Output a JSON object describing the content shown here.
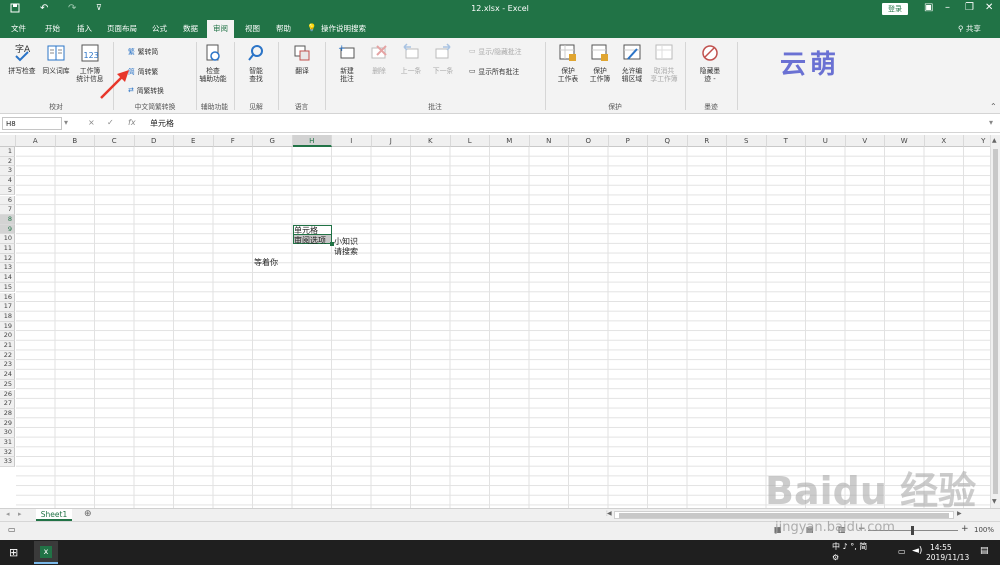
{
  "titlebar": {
    "title": "12.xlsx  -  Excel",
    "login_label": "登录",
    "save_icon": "save-icon",
    "undo_icon": "undo-icon",
    "redo_icon": "redo-icon",
    "customize_icon": "customize-icon"
  },
  "tabs": [
    {
      "label": "文件"
    },
    {
      "label": "开始"
    },
    {
      "label": "插入"
    },
    {
      "label": "页面布局"
    },
    {
      "label": "公式"
    },
    {
      "label": "数据"
    },
    {
      "label": "审阅",
      "active": true
    },
    {
      "label": "视图"
    },
    {
      "label": "帮助"
    },
    {
      "label": "操作说明搜索"
    }
  ],
  "share_label": "共享",
  "ribbon": {
    "proofing": {
      "spell_label": "拼写检查",
      "thesaurus_label": "同义词库",
      "stats_label_1": "工作簿",
      "stats_label_2": "统计信息",
      "group_label": "校对"
    },
    "chinese": {
      "to_simplified": "繁转简",
      "to_traditional": "简转繁",
      "convert": "简繁转换",
      "group_label": "中文简繁转换"
    },
    "accessibility": {
      "check_label_1": "检查",
      "check_label_2": "辅助功能",
      "group_label": "辅助功能"
    },
    "insights": {
      "smart_label_1": "智能",
      "smart_label_2": "查找",
      "group_label": "见解"
    },
    "language": {
      "translate_label": "翻译",
      "group_label": "语言"
    },
    "comments": {
      "new_label_1": "新建",
      "new_label_2": "批注",
      "delete_label": "删除",
      "prev_label": "上一条",
      "next_label": "下一条",
      "show_hide_label": "显示/隐藏批注",
      "show_all_label": "显示所有批注",
      "group_label": "批注"
    },
    "protect": {
      "sheet_1": "保护",
      "sheet_2": "工作表",
      "book_1": "保护",
      "book_2": "工作簿",
      "ranges_1": "允许编",
      "ranges_2": "辑区域",
      "unshare_1": "取消共",
      "unshare_2": "享工作簿",
      "group_label": "保护"
    },
    "ink": {
      "hide_1": "隐藏墨",
      "hide_2": "迹 -",
      "group_label": "墨迹"
    }
  },
  "formula_bar": {
    "name_box": "H8",
    "cancel": "×",
    "enter": "✓",
    "fx": "fx",
    "content": "单元格"
  },
  "columns": [
    "A",
    "B",
    "C",
    "D",
    "E",
    "F",
    "G",
    "H",
    "I",
    "J",
    "K",
    "L",
    "M",
    "N",
    "O",
    "P",
    "Q",
    "R",
    "S",
    "T",
    "U",
    "V",
    "W",
    "X",
    "Y"
  ],
  "selected_column": "H",
  "rows": [
    "1",
    "2",
    "3",
    "4",
    "5",
    "6",
    "7",
    "8",
    "9",
    "10",
    "11",
    "12",
    "13",
    "14",
    "15",
    "16",
    "17",
    "18",
    "19",
    "20",
    "21",
    "22",
    "23",
    "24",
    "25",
    "26",
    "27",
    "28",
    "29",
    "30",
    "31",
    "32",
    "33"
  ],
  "selected_rows": [
    "8",
    "9"
  ],
  "cells": {
    "H8": "单元格",
    "H9": "审阅选项",
    "I9": "小知识",
    "I10": "请搜索",
    "G11": "等着你"
  },
  "sheet_tab": "Sheet1",
  "status": {
    "zoom": "100%"
  },
  "taskbar": {
    "ime": "中 ♪ °, 简",
    "time": "14:55",
    "date": "2019/11/13"
  },
  "watermark": {
    "brand": "Baidu 经验",
    "url": "jingyan.baidu.com",
    "logo_text": "云萌"
  },
  "colors": {
    "excel_green": "#217346",
    "ribbon_bg": "#f3f3f3",
    "selection_fill": "#c6c6c6",
    "annotation_arrow": "#e8362a"
  }
}
